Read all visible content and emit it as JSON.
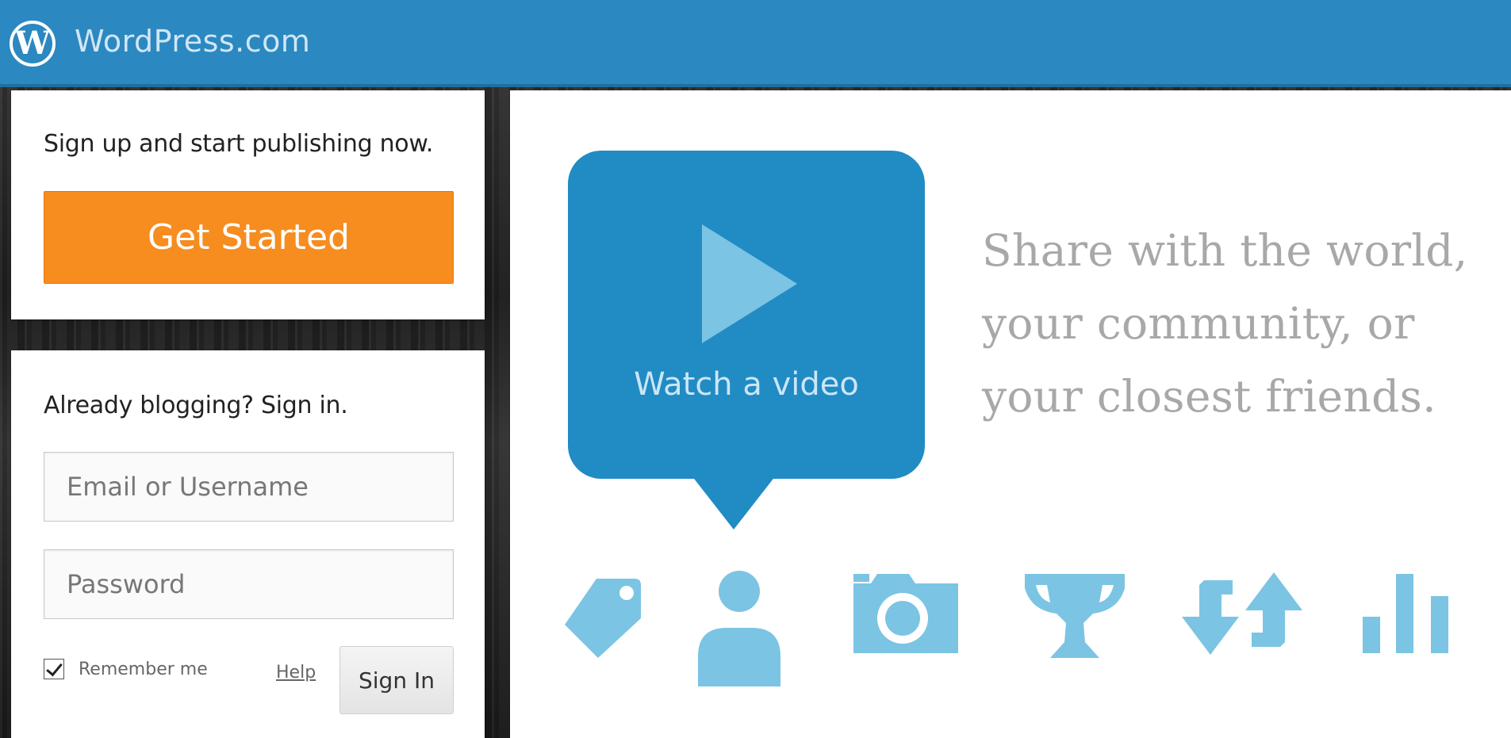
{
  "header": {
    "logo_letter": "W",
    "brand": "WordPress.com"
  },
  "signup": {
    "heading": "Sign up and start publishing now.",
    "button_label": "Get Started"
  },
  "signin": {
    "heading": "Already blogging? Sign in.",
    "email_placeholder": "Email or Username",
    "password_placeholder": "Password",
    "remember_label": "Remember me",
    "remember_checked": true,
    "help_label": "Help",
    "button_label": "Sign In"
  },
  "hero": {
    "video_label": "Watch a video",
    "tagline": [
      "Share with the world,",
      "your community, or",
      "your closest friends."
    ]
  },
  "feature_icons": [
    "tag-icon",
    "person-icon",
    "camera-icon",
    "trophy-icon",
    "swap-arrows-icon",
    "bar-chart-icon"
  ],
  "colors": {
    "header_blue": "#2b88c1",
    "bubble_blue": "#218bc4",
    "icon_blue": "#7cc4e3",
    "orange": "#f78c1f",
    "tagline_gray": "#a8a8a8"
  }
}
